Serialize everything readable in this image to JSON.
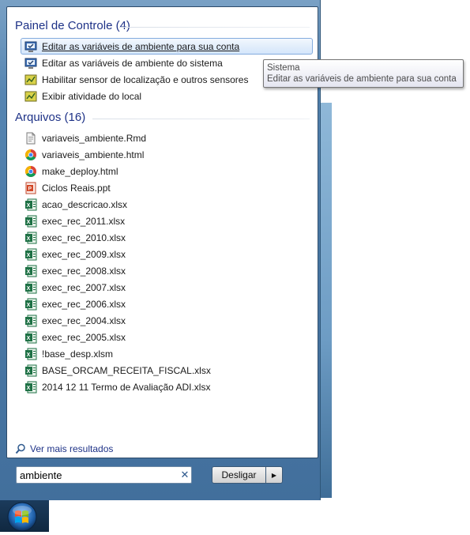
{
  "control_panel": {
    "title": "Painel de Controle (4)",
    "items": [
      {
        "label": "Editar as variáveis de ambiente para sua conta",
        "icon": "system-properties-icon"
      },
      {
        "label": "Editar as variáveis de ambiente do sistema",
        "icon": "system-properties-icon"
      },
      {
        "label": "Habilitar sensor de localização e outros sensores",
        "icon": "location-sensor-icon"
      },
      {
        "label": "Exibir atividade do local",
        "icon": "location-sensor-icon"
      }
    ]
  },
  "files": {
    "title": "Arquivos (16)",
    "items": [
      {
        "label": "variaveis_ambiente.Rmd",
        "icon": "document-icon"
      },
      {
        "label": "variaveis_ambiente.html",
        "icon": "chrome-icon"
      },
      {
        "label": "make_deploy.html",
        "icon": "chrome-icon"
      },
      {
        "label": "Ciclos Reais.ppt",
        "icon": "powerpoint-icon"
      },
      {
        "label": "acao_descricao.xlsx",
        "icon": "excel-icon"
      },
      {
        "label": "exec_rec_2011.xlsx",
        "icon": "excel-icon"
      },
      {
        "label": "exec_rec_2010.xlsx",
        "icon": "excel-icon"
      },
      {
        "label": "exec_rec_2009.xlsx",
        "icon": "excel-icon"
      },
      {
        "label": "exec_rec_2008.xlsx",
        "icon": "excel-icon"
      },
      {
        "label": "exec_rec_2007.xlsx",
        "icon": "excel-icon"
      },
      {
        "label": "exec_rec_2006.xlsx",
        "icon": "excel-icon"
      },
      {
        "label": "exec_rec_2004.xlsx",
        "icon": "excel-icon"
      },
      {
        "label": "exec_rec_2005.xlsx",
        "icon": "excel-icon"
      },
      {
        "label": "!base_desp.xlsm",
        "icon": "excel-icon"
      },
      {
        "label": "BASE_ORCAM_RECEITA_FISCAL.xlsx",
        "icon": "excel-icon"
      },
      {
        "label": "2014 12 11 Termo de Avaliação ADI.xlsx",
        "icon": "excel-icon"
      }
    ]
  },
  "more_results": "Ver mais resultados",
  "search": {
    "value": "ambiente",
    "clear_icon": "clear-icon"
  },
  "shutdown": {
    "label": "Desligar",
    "arrow_icon": "chevron-right-icon"
  },
  "tooltip": {
    "line1": "Sistema",
    "line2": "Editar as variáveis de ambiente para sua conta"
  },
  "colors": {
    "group_title": "#1e3287",
    "selection_border": "#84acdd",
    "frame": "#4b7aa7"
  }
}
